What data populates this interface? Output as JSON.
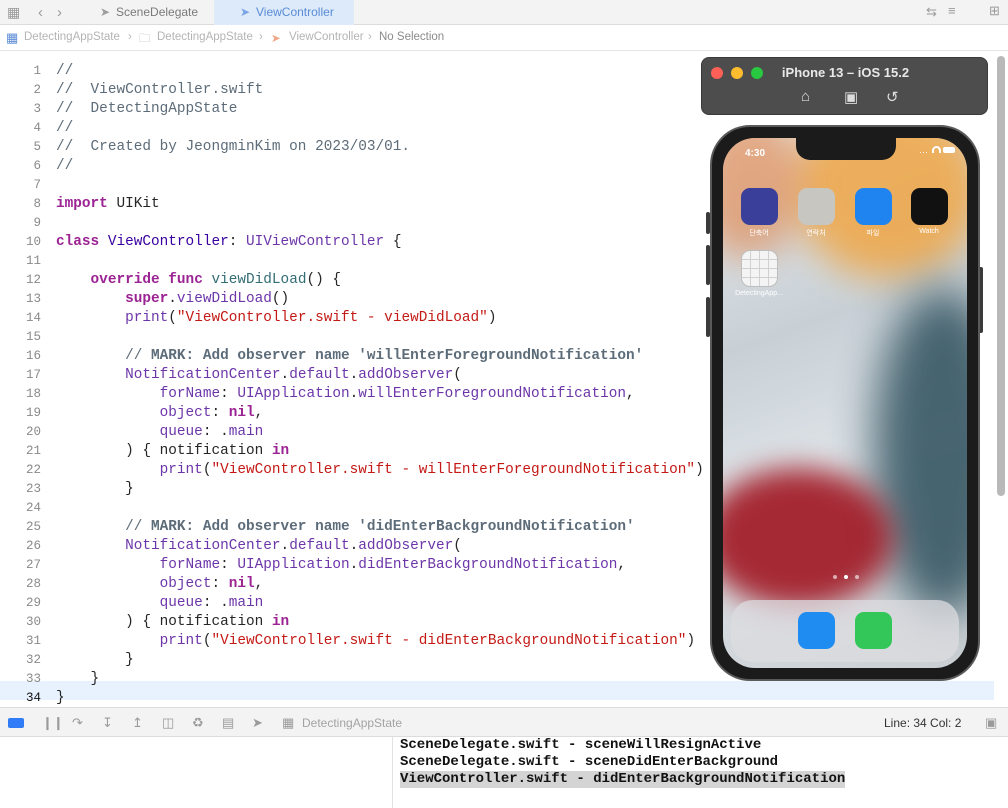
{
  "tabs": {
    "inactive": "SceneDelegate",
    "active": "ViewController"
  },
  "breadcrumb": [
    "DetectingAppState",
    "DetectingAppState",
    "ViewController",
    "No Selection"
  ],
  "editor": {
    "current_line": 34,
    "lines": [
      [
        {
          "t": "//",
          "c": "cm"
        }
      ],
      [
        {
          "t": "//  ViewController.swift",
          "c": "cm"
        }
      ],
      [
        {
          "t": "//  DetectingAppState",
          "c": "cm"
        }
      ],
      [
        {
          "t": "//",
          "c": "cm"
        }
      ],
      [
        {
          "t": "//  Created by JeongminKim on 2023/03/01.",
          "c": "cm"
        }
      ],
      [
        {
          "t": "//",
          "c": "cm"
        }
      ],
      [],
      [
        {
          "t": "import",
          "c": "kw"
        },
        {
          "t": " UIKit",
          "c": ""
        }
      ],
      [],
      [
        {
          "t": "class",
          "c": "kw"
        },
        {
          "t": " ",
          "c": ""
        },
        {
          "t": "ViewController",
          "c": "ty"
        },
        {
          "t": ": ",
          "c": ""
        },
        {
          "t": "UIViewController",
          "c": "pr"
        },
        {
          "t": " {",
          "c": ""
        }
      ],
      [],
      [
        {
          "t": "    ",
          "c": ""
        },
        {
          "t": "override",
          "c": "kw"
        },
        {
          "t": " ",
          "c": ""
        },
        {
          "t": "func",
          "c": "kw"
        },
        {
          "t": " ",
          "c": ""
        },
        {
          "t": "viewDidLoad",
          "c": "fn"
        },
        {
          "t": "() {",
          "c": ""
        }
      ],
      [
        {
          "t": "        ",
          "c": ""
        },
        {
          "t": "super",
          "c": "kw"
        },
        {
          "t": ".",
          "c": ""
        },
        {
          "t": "viewDidLoad",
          "c": "md"
        },
        {
          "t": "()",
          "c": ""
        }
      ],
      [
        {
          "t": "        ",
          "c": ""
        },
        {
          "t": "print",
          "c": "md"
        },
        {
          "t": "(",
          "c": ""
        },
        {
          "t": "\"ViewController.swift - viewDidLoad\"",
          "c": "st"
        },
        {
          "t": ")",
          "c": ""
        }
      ],
      [],
      [
        {
          "t": "        // ",
          "c": "cm"
        },
        {
          "t": "MARK: Add observer name 'willEnterForegroundNotification'",
          "c": "mk"
        }
      ],
      [
        {
          "t": "        ",
          "c": ""
        },
        {
          "t": "NotificationCenter",
          "c": "pr"
        },
        {
          "t": ".",
          "c": ""
        },
        {
          "t": "default",
          "c": "md"
        },
        {
          "t": ".",
          "c": ""
        },
        {
          "t": "addObserver",
          "c": "md"
        },
        {
          "t": "(",
          "c": ""
        }
      ],
      [
        {
          "t": "            ",
          "c": ""
        },
        {
          "t": "forName",
          "c": "md"
        },
        {
          "t": ": ",
          "c": ""
        },
        {
          "t": "UIApplication",
          "c": "pr"
        },
        {
          "t": ".",
          "c": ""
        },
        {
          "t": "willEnterForegroundNotification",
          "c": "md"
        },
        {
          "t": ",",
          "c": ""
        }
      ],
      [
        {
          "t": "            ",
          "c": ""
        },
        {
          "t": "object",
          "c": "md"
        },
        {
          "t": ": ",
          "c": ""
        },
        {
          "t": "nil",
          "c": "kw"
        },
        {
          "t": ",",
          "c": ""
        }
      ],
      [
        {
          "t": "            ",
          "c": ""
        },
        {
          "t": "queue",
          "c": "md"
        },
        {
          "t": ": .",
          "c": ""
        },
        {
          "t": "main",
          "c": "md"
        }
      ],
      [
        {
          "t": "        ) { notification ",
          "c": ""
        },
        {
          "t": "in",
          "c": "kw"
        }
      ],
      [
        {
          "t": "            ",
          "c": ""
        },
        {
          "t": "print",
          "c": "md"
        },
        {
          "t": "(",
          "c": ""
        },
        {
          "t": "\"ViewController.swift - willEnterForegroundNotification\"",
          "c": "st"
        },
        {
          "t": ")",
          "c": ""
        }
      ],
      [
        {
          "t": "        }",
          "c": ""
        }
      ],
      [],
      [
        {
          "t": "        // ",
          "c": "cm"
        },
        {
          "t": "MARK: Add observer name 'didEnterBackgroundNotification'",
          "c": "mk"
        }
      ],
      [
        {
          "t": "        ",
          "c": ""
        },
        {
          "t": "NotificationCenter",
          "c": "pr"
        },
        {
          "t": ".",
          "c": ""
        },
        {
          "t": "default",
          "c": "md"
        },
        {
          "t": ".",
          "c": ""
        },
        {
          "t": "addObserver",
          "c": "md"
        },
        {
          "t": "(",
          "c": ""
        }
      ],
      [
        {
          "t": "            ",
          "c": ""
        },
        {
          "t": "forName",
          "c": "md"
        },
        {
          "t": ": ",
          "c": ""
        },
        {
          "t": "UIApplication",
          "c": "pr"
        },
        {
          "t": ".",
          "c": ""
        },
        {
          "t": "didEnterBackgroundNotification",
          "c": "md"
        },
        {
          "t": ",",
          "c": ""
        }
      ],
      [
        {
          "t": "            ",
          "c": ""
        },
        {
          "t": "object",
          "c": "md"
        },
        {
          "t": ": ",
          "c": ""
        },
        {
          "t": "nil",
          "c": "kw"
        },
        {
          "t": ",",
          "c": ""
        }
      ],
      [
        {
          "t": "            ",
          "c": ""
        },
        {
          "t": "queue",
          "c": "md"
        },
        {
          "t": ": .",
          "c": ""
        },
        {
          "t": "main",
          "c": "md"
        }
      ],
      [
        {
          "t": "        ) { notification ",
          "c": ""
        },
        {
          "t": "in",
          "c": "kw"
        }
      ],
      [
        {
          "t": "            ",
          "c": ""
        },
        {
          "t": "print",
          "c": "md"
        },
        {
          "t": "(",
          "c": ""
        },
        {
          "t": "\"ViewController.swift - didEnterBackgroundNotification\"",
          "c": "st"
        },
        {
          "t": ")",
          "c": ""
        }
      ],
      [
        {
          "t": "        }",
          "c": ""
        }
      ],
      [
        {
          "t": "    }",
          "c": ""
        }
      ],
      [
        {
          "t": "}",
          "c": ""
        }
      ]
    ]
  },
  "debug": {
    "scheme": "DetectingAppState",
    "position": "Line: 34  Col: 2"
  },
  "console": {
    "lines": [
      "SceneDelegate.swift - sceneWillResignActive",
      "SceneDelegate.swift - sceneDidEnterBackground",
      "ViewController.swift - didEnterBackgroundNotification"
    ]
  },
  "simulator": {
    "title": "iPhone 13 – iOS 15.2",
    "time": "4:30",
    "apps": [
      {
        "label": "단축어",
        "icon": "shortcuts-icon",
        "color": "#3a3f9a"
      },
      {
        "label": "연락처",
        "icon": "contacts-icon",
        "color": "#c8c6c0"
      },
      {
        "label": "파일",
        "icon": "files-icon",
        "color": "#1f83f0"
      },
      {
        "label": "Watch",
        "icon": "watch-icon",
        "color": "#111111"
      },
      {
        "label": "DetectingApp...",
        "icon": "app-placeholder-icon",
        "color": "#f4f4f4"
      }
    ],
    "dock": [
      {
        "icon": "safari-icon",
        "color": "#1e8cf0"
      },
      {
        "icon": "messages-icon",
        "color": "#33c759"
      }
    ]
  }
}
